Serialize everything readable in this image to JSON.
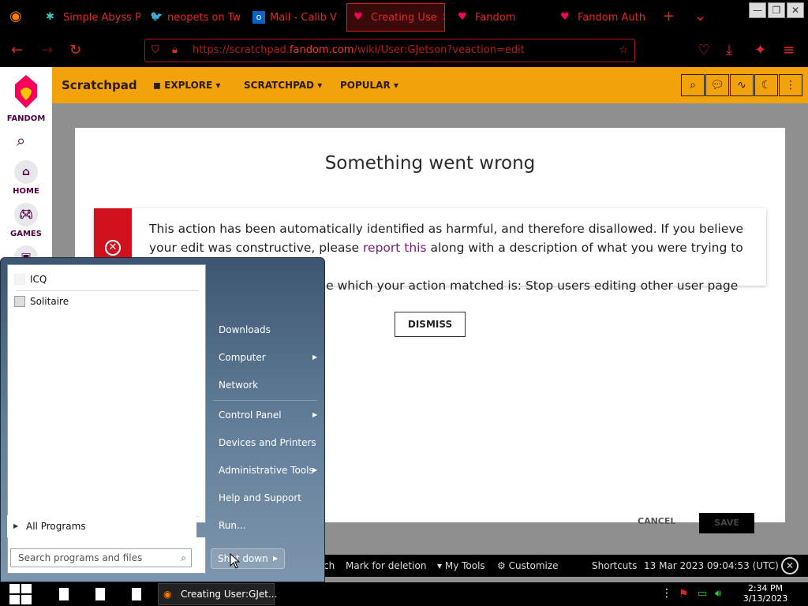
{
  "browser": {
    "tabs": [
      {
        "label": "Simple Abyss P",
        "active": false
      },
      {
        "label": "neopets on Tw",
        "active": false
      },
      {
        "label": "Mail - Calib V",
        "active": false
      },
      {
        "label": "Creating Use",
        "active": true
      },
      {
        "label": "Fandom",
        "active": false
      },
      {
        "label": "Fandom Auth",
        "active": false
      }
    ],
    "url_prefix": "https://scratchpad.",
    "url_domain": "fandom.com",
    "url_suffix": "/wiki/User:GJetson?veaction=edit"
  },
  "fandom_sidebar": {
    "logo_text": "FANDOM",
    "home": "HOME",
    "games": "GAMES"
  },
  "wiki_header": {
    "name": "Scratchpad",
    "nav": [
      "EXPLORE",
      "SCRATCHPAD",
      "POPULAR"
    ]
  },
  "modal": {
    "title": "Something went wrong",
    "error_text_1": "This action has been automatically identified as harmful, and therefore disallowed. If you believe your edit was constructive, please ",
    "error_link": "report this",
    "error_text_2": " along with a description of what you were trying to do. A brief",
    "error_text_3": "ule which your action matched is: Stop users editing other user page",
    "dismiss_label": "DISMISS",
    "cancel_label": "CANCEL",
    "save_label": "SAVE"
  },
  "fandom_toolbar": {
    "items": [
      "ch",
      "Mark for deletion",
      "My Tools",
      "Customize",
      "Shortcuts"
    ],
    "timestamp": "13 Mar 2023 09:04:53 (UTC)"
  },
  "start_menu": {
    "programs": [
      "ICQ",
      "Solitaire"
    ],
    "all_programs": "All Programs",
    "search_placeholder": "Search programs and files",
    "right_items": [
      "Downloads",
      "Computer",
      "Network",
      "Control Panel",
      "Devices and Printers",
      "Administrative Tools",
      "Help and Support",
      "Run..."
    ],
    "shutdown": "Shut down"
  },
  "taskbar": {
    "firefox_window": "Creating User:GJet...",
    "time": "2:34 PM",
    "date": "3/13/2023"
  },
  "colors": {
    "fandom_orange": "#f2a20b",
    "error_red": "#d0111d",
    "browser_accent": "#e02828"
  }
}
